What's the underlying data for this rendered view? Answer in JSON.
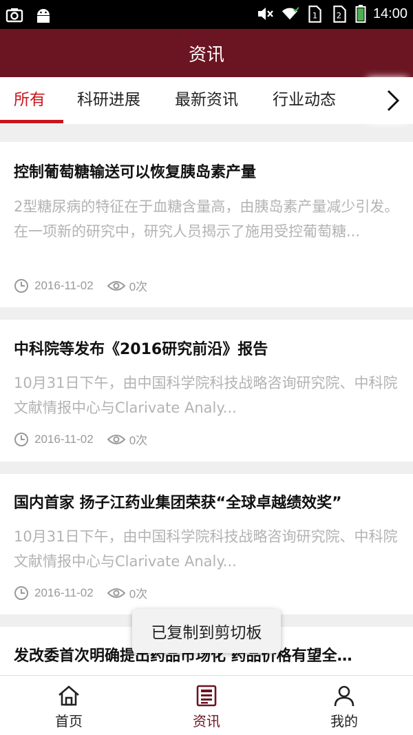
{
  "status_bar": {
    "time": "14:00",
    "icons": [
      "camera-icon",
      "android-icon",
      "mute-icon",
      "wifi-icon",
      "sim1-icon",
      "sim2-icon",
      "battery-icon"
    ]
  },
  "app_bar": {
    "title": "资讯"
  },
  "tabs": [
    {
      "label": "所有",
      "active": true
    },
    {
      "label": "科研进展",
      "active": false
    },
    {
      "label": "最新资讯",
      "active": false
    },
    {
      "label": "行业动态",
      "active": false
    }
  ],
  "tab_more_icon": "chevron-right-icon",
  "articles": [
    {
      "title": "控制葡萄糖输送可以恢复胰岛素产量",
      "summary": "2型糖尿病的特征在于血糖含量高，由胰岛素产量减少引发。在一项新的研究中，研究人员揭示了施用受控葡萄糖...",
      "date": "2016-11-02",
      "views": "0次"
    },
    {
      "title": "中科院等发布《2016研究前沿》报告",
      "summary": "10月31日下午，由中国科学院科技战略咨询研究院、中科院文献情报中心与Clarivate Analy...",
      "date": "2016-11-02",
      "views": "0次"
    },
    {
      "title": "国内首家 扬子江药业集团荣获“全球卓越绩效奖”",
      "summary": "10月31日下午，由中国科学院科技战略咨询研究院、中科院文献情报中心与Clarivate Analy...",
      "date": "2016-11-02",
      "views": "0次"
    },
    {
      "title": "发改委首次明确提出药品市场化 药品价格有望全…"
    }
  ],
  "toast": {
    "text": "已复制到剪切板"
  },
  "bottom_nav": [
    {
      "label": "首页",
      "icon": "home-icon",
      "active": false
    },
    {
      "label": "资讯",
      "icon": "news-icon",
      "active": true
    },
    {
      "label": "我的",
      "icon": "person-icon",
      "active": false
    }
  ],
  "colors": {
    "brand": "#6b1422",
    "accent": "#c8161d",
    "muted_text": "#b3b3b3",
    "meta_text": "#999999"
  }
}
